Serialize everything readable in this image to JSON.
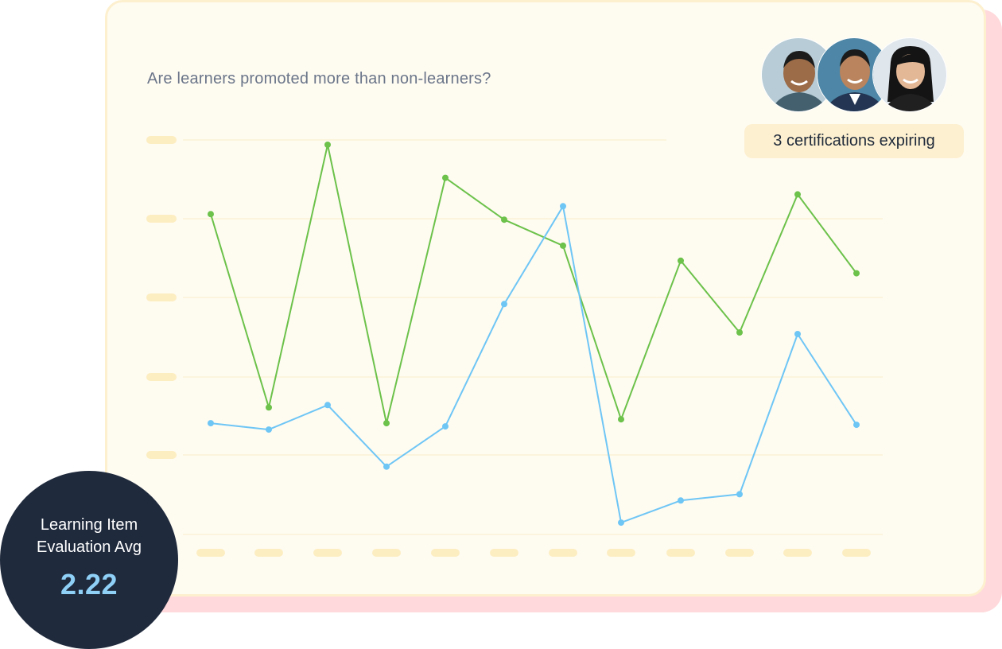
{
  "chart_title": "Are learners promoted more than non-learners?",
  "certifications_badge": "3 certifications expiring",
  "avatars": [
    {
      "name": "avatar-person-1",
      "bg": "#b7ccd6"
    },
    {
      "name": "avatar-person-2",
      "bg": "#4d86a6"
    },
    {
      "name": "avatar-person-3",
      "bg": "#dfe6ec"
    }
  ],
  "kpi": {
    "label": "Learning Item Evaluation Avg",
    "value": "2.22"
  },
  "colors": {
    "green_series": "#6cc24a",
    "blue_series": "#6ec6f5",
    "placeholder_tick": "#fdeec2",
    "gridline": "#fbf1d6"
  },
  "chart_data": {
    "type": "line",
    "x": [
      1,
      2,
      3,
      4,
      5,
      6,
      7,
      8,
      9,
      10,
      11,
      12
    ],
    "ylim": [
      0,
      5
    ],
    "series": [
      {
        "color": "#6cc24a",
        "values": [
          4.06,
          1.61,
          4.94,
          1.41,
          4.52,
          3.99,
          3.66,
          1.46,
          3.47,
          2.56,
          4.31,
          3.31
        ]
      },
      {
        "color": "#6ec6f5",
        "values": [
          1.41,
          1.33,
          1.64,
          0.86,
          1.37,
          2.92,
          4.16,
          0.15,
          0.43,
          0.51,
          2.54,
          1.39
        ]
      }
    ],
    "grid": true,
    "tick_labels_shown": false,
    "legend": "none"
  }
}
